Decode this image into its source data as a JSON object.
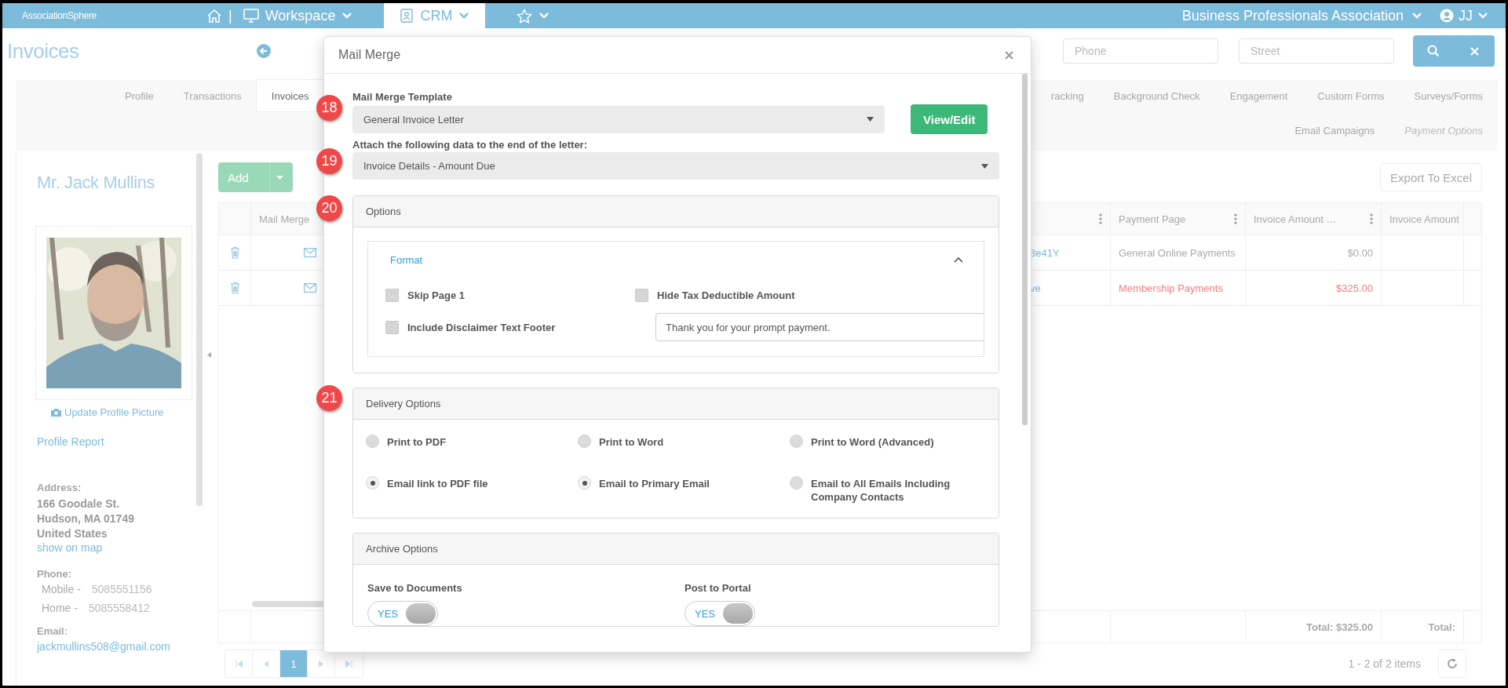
{
  "top_bar": {
    "logo": "AssociationSphere",
    "separator": "|",
    "nav": [
      {
        "label": "Workspace",
        "selected": false
      },
      {
        "label": "CRM",
        "selected": true
      }
    ],
    "organization": "Business Professionals Association",
    "user": "JJ"
  },
  "header": {
    "title": "Invoices",
    "search_fields": [
      {
        "placeholder": "Phone"
      },
      {
        "placeholder": "Street"
      }
    ]
  },
  "tabs": {
    "row_1_left": [
      {
        "label": "Profile",
        "selected": false,
        "disabled": false
      },
      {
        "label": "Transactions",
        "selected": false,
        "disabled": false
      },
      {
        "label": "Invoices",
        "selected": true,
        "disabled": false
      }
    ],
    "row_1_right": [
      {
        "label": "racking",
        "selected": false,
        "disabled": false
      },
      {
        "label": "Background Check",
        "selected": false,
        "disabled": false
      },
      {
        "label": "Engagement",
        "selected": false,
        "disabled": false
      },
      {
        "label": "Custom Forms",
        "selected": false,
        "disabled": false
      },
      {
        "label": "Surveys/Forms",
        "selected": false,
        "disabled": false
      }
    ],
    "row_2": [
      {
        "label": "Email Campaigns",
        "selected": false,
        "disabled": false
      },
      {
        "label": "Payment Options",
        "selected": false,
        "disabled": true
      }
    ]
  },
  "profile": {
    "name": "Mr. Jack Mullins",
    "photo": {
      "kind": "picture"
    },
    "update_picture": "Update Profile Picture",
    "profile_report": "Profile Report",
    "address_label": "Address:",
    "address_lines": [
      "166 Goodale St.",
      "Hudson, MA 01749",
      "United States"
    ],
    "map_link": "show on map",
    "phone_label": "Phone:",
    "phones": [
      {
        "type": "Mobile -",
        "number": "5085551156"
      },
      {
        "type": "Home -",
        "number": "5085558412"
      }
    ],
    "email_label": "Email:",
    "email": "jackmullins508@gmail.com"
  },
  "grid": {
    "add_button": "Add",
    "export_button": "Export To Excel",
    "columns": [
      "Mail Merge",
      "Payment Page",
      "Invoice Amount …",
      "Invoice Amount"
    ],
    "rows": [
      {
        "column_3": "3e41Y",
        "payment_page": "General Online Payments",
        "amount": "$0.00",
        "highlighted": false
      },
      {
        "column_3": "ve",
        "payment_page": "Membership Payments",
        "amount": "$325.00",
        "highlighted": true
      }
    ],
    "totals": [
      "Total: $325.00",
      "Total:"
    ],
    "pages": [
      {
        "label": "1",
        "selected": true
      }
    ],
    "summary": "1 - 2 of 2 items"
  },
  "modal": {
    "title": "Mail Merge",
    "template": {
      "callout": "18",
      "label": "Mail Merge Template",
      "value": "General Invoice Letter",
      "button": "View/Edit"
    },
    "attach": {
      "callout": "19",
      "label": "Attach the following data to the end of the letter:",
      "value": "Invoice Details - Amount Due"
    },
    "options": {
      "callout": "20",
      "title": "Options",
      "format": {
        "title": "Format",
        "expanded": true,
        "checkboxes": [
          {
            "label": "Skip Page 1",
            "checked": false
          },
          {
            "label": "Hide Tax Deductible Amount",
            "checked": false
          },
          {
            "label": "Include Disclaimer Text Footer",
            "checked": false
          }
        ],
        "footer_text": "Thank you for your prompt payment."
      }
    },
    "delivery": {
      "callout": "21",
      "title": "Delivery Options",
      "options": [
        {
          "label": "Print to PDF",
          "selected": false
        },
        {
          "label": "Print to Word",
          "selected": false
        },
        {
          "label": "Print to Word (Advanced)",
          "selected": false
        },
        {
          "label": "Email link to PDF file",
          "selected": true
        },
        {
          "label": "Email to Primary Email",
          "selected": true
        },
        {
          "label": "Email to All Emails Including Company Contacts",
          "selected": false
        }
      ]
    },
    "archive": {
      "title": "Archive Options",
      "toggles": [
        {
          "label": "Save to Documents",
          "state_label": "YES",
          "on": true
        },
        {
          "label": "Post to Portal",
          "state_label": "YES",
          "on": true
        }
      ]
    }
  }
}
